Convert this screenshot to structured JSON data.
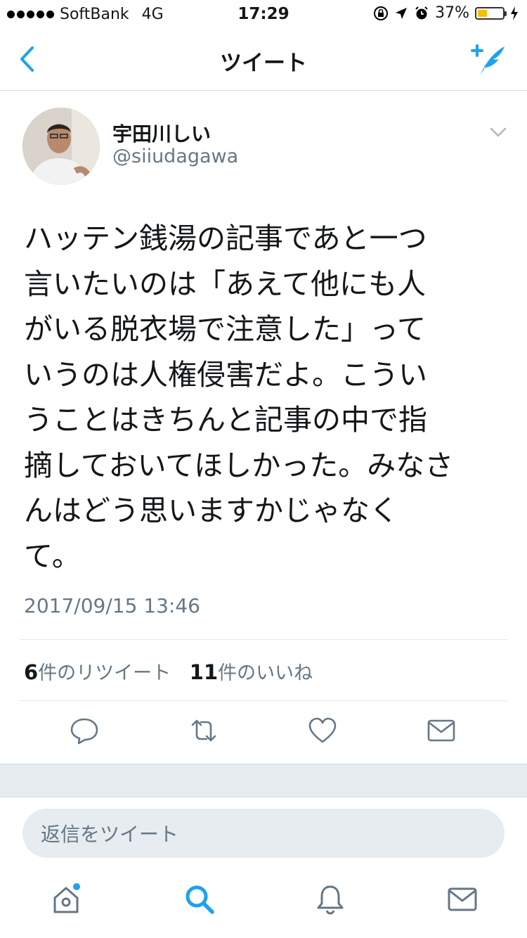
{
  "status_bar": {
    "carrier": "SoftBank",
    "network": "4G",
    "time": "17:29",
    "battery_percent": "37%",
    "battery_level": 0.37
  },
  "nav": {
    "title": "ツイート",
    "back_icon": "chevron-left-icon",
    "compose_icon": "compose-tweet-icon"
  },
  "tweet": {
    "author_name": "宇田川しい",
    "author_handle": "@siiudagawa",
    "text_lines": [
      "ハッテン銭湯の記事であと一つ",
      "言いたいのは「あえて他にも人",
      "がいる脱衣場で注意した」って",
      "いうのは人権侵害だよ。こうい",
      "うことはきちんと記事の中で指",
      "摘しておいてほしかった。みなさ",
      "んはどう思いますかじゃなく",
      "て。"
    ],
    "timestamp": "2017/09/15 13:46",
    "retweet_count": "6",
    "retweet_label": "件のリツイート",
    "like_count": "11",
    "like_label": "件のいいね"
  },
  "actions": {
    "reply_icon": "reply-icon",
    "retweet_icon": "retweet-icon",
    "like_icon": "heart-icon",
    "dm_icon": "mail-icon"
  },
  "reply": {
    "placeholder": "返信をツイート"
  },
  "tab_bar": {
    "items": [
      "home-icon",
      "search-icon",
      "notifications-icon",
      "messages-icon"
    ]
  },
  "colors": {
    "accent": "#1da1f2",
    "secondary_text": "#657786",
    "battery": "#f5c000"
  }
}
